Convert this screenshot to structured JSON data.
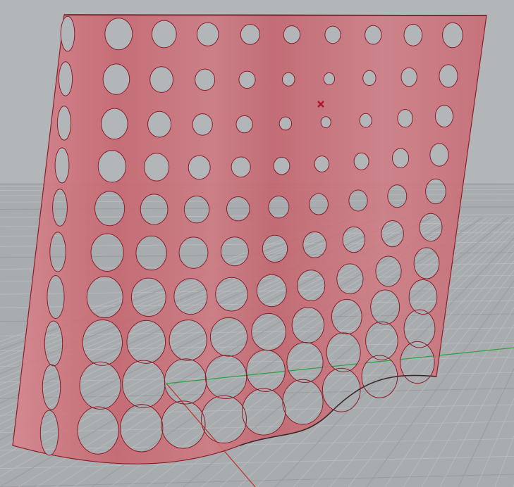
{
  "viewport": {
    "view": "Perspective",
    "colors": {
      "background": "#a9acaf",
      "grid_minor": "#bdbfc1",
      "grid_major": "#9a9ca0",
      "surface_fill": "#c96a73",
      "surface_edge": "#8a1f2b",
      "selected_marker": "#b3122b",
      "x_axis": "#c0392b",
      "y_axis": "#2ea043"
    },
    "object": {
      "type": "perforated surface",
      "hole_rows": 10,
      "hole_columns": 10,
      "selected": true
    },
    "marker": {
      "icon": "selected-point-x-icon"
    }
  }
}
